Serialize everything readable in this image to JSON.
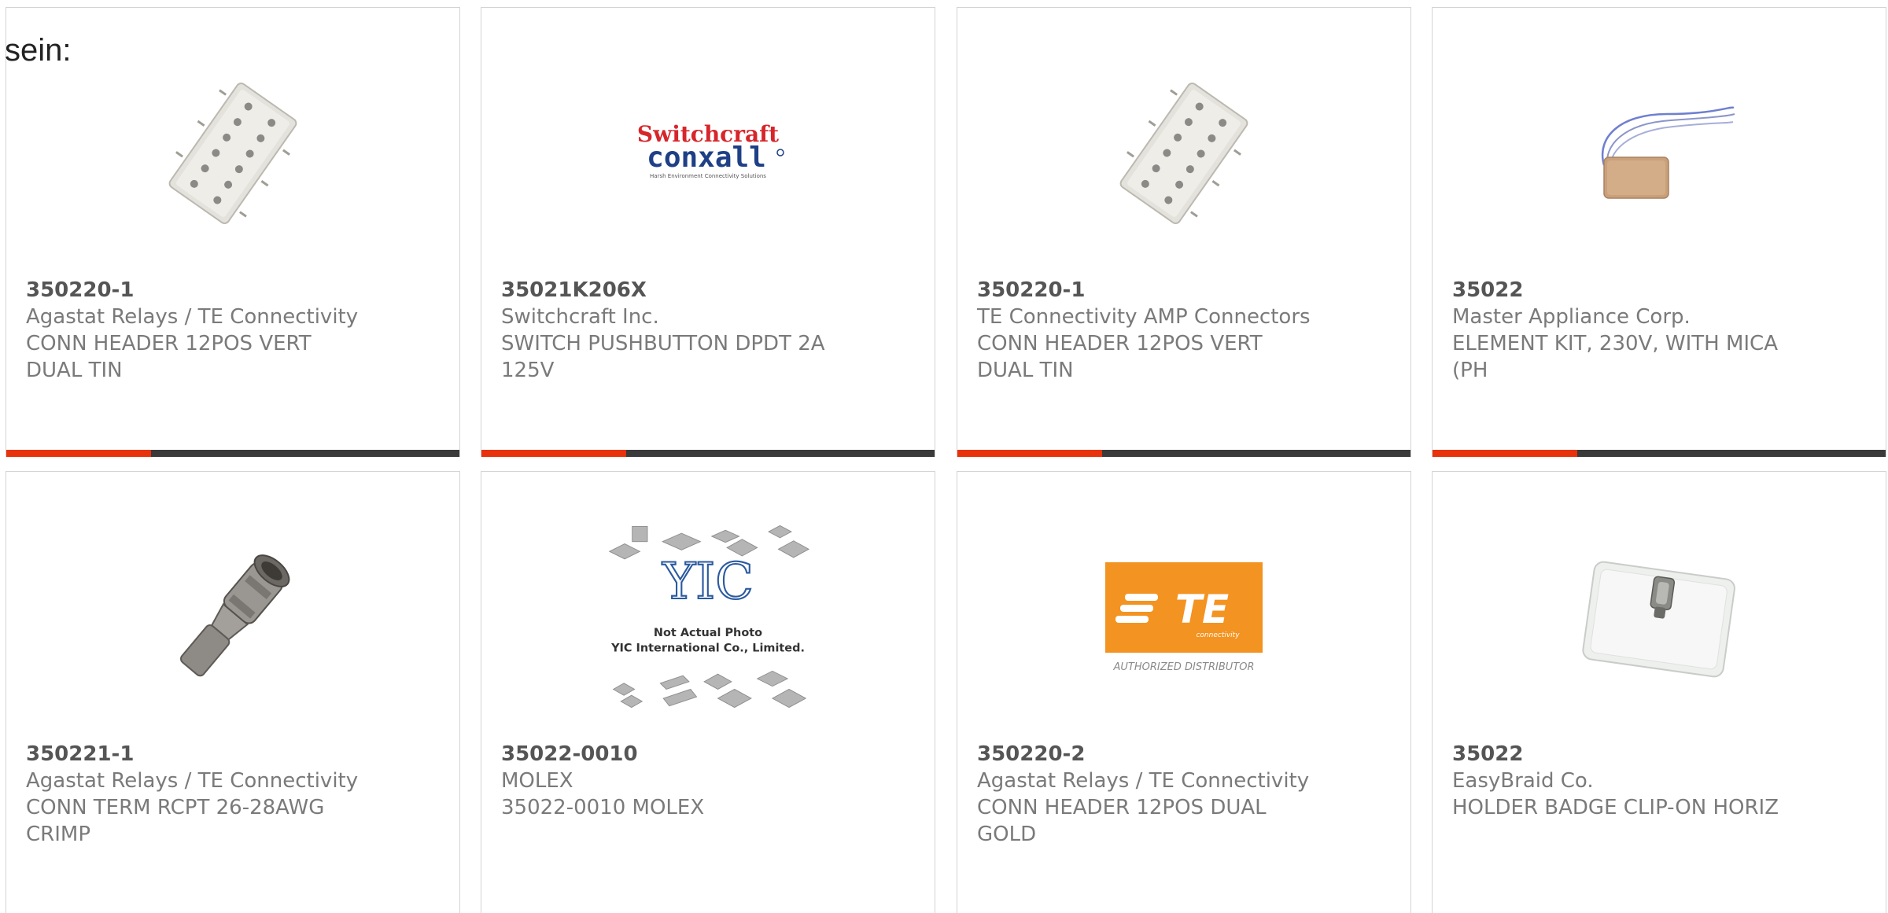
{
  "intro_text": "sein:",
  "colors": {
    "accent": "#e8320c",
    "bar": "#3a3a3a",
    "card_border": "#d4d4d4",
    "text_gray": "#7a7a7a",
    "part_gray": "#555555"
  },
  "cards": [
    {
      "part": "350220-1",
      "manufacturer": "Agastat Relays / TE Connectivity",
      "desc1": "CONN HEADER 12POS VERT",
      "desc2": "DUAL TIN",
      "image": "connector-header-photo"
    },
    {
      "part": "35021K206X",
      "manufacturer": "Switchcraft Inc.",
      "desc1": "SWITCH PUSHBUTTON DPDT 2A",
      "desc2": "125V",
      "image": "switchcraft-conxall-logo",
      "logo_top": "Switchcraft",
      "logo_bottom": "conxall",
      "logo_tag": "Harsh Environment Connectivity Solutions"
    },
    {
      "part": "350220-1",
      "manufacturer": "TE Connectivity AMP Connectors",
      "desc1": "CONN HEADER 12POS VERT",
      "desc2": "DUAL TIN",
      "image": "connector-header-photo"
    },
    {
      "part": "35022",
      "manufacturer": "Master Appliance Corp.",
      "desc1": "ELEMENT KIT, 230V, WITH MICA",
      "desc2": "(PH",
      "image": "heating-element-photo"
    },
    {
      "part": "350221-1",
      "manufacturer": "Agastat Relays / TE Connectivity",
      "desc1": "CONN TERM RCPT 26-28AWG",
      "desc2": "CRIMP",
      "image": "crimp-terminal-photo"
    },
    {
      "part": "35022-0010",
      "manufacturer": "MOLEX",
      "desc1": "35022-0010 MOLEX",
      "desc2": "",
      "image": "not-actual-photo-placeholder",
      "logo_mark": "YIC",
      "placeholder_line1": "Not Actual Photo",
      "placeholder_line2": "YIC International Co., Limited."
    },
    {
      "part": "350220-2",
      "manufacturer": "Agastat Relays / TE Connectivity",
      "desc1": "CONN HEADER 12POS DUAL",
      "desc2": "GOLD",
      "image": "te-authorized-distributor-logo",
      "logo_mark": "TE",
      "logo_sub": "connectivity",
      "logo_caption": "AUTHORIZED DISTRIBUTOR"
    },
    {
      "part": "35022",
      "manufacturer": "EasyBraid Co.",
      "desc1": "HOLDER BADGE CLIP-ON HORIZ",
      "desc2": "",
      "image": "badge-holder-photo"
    }
  ]
}
